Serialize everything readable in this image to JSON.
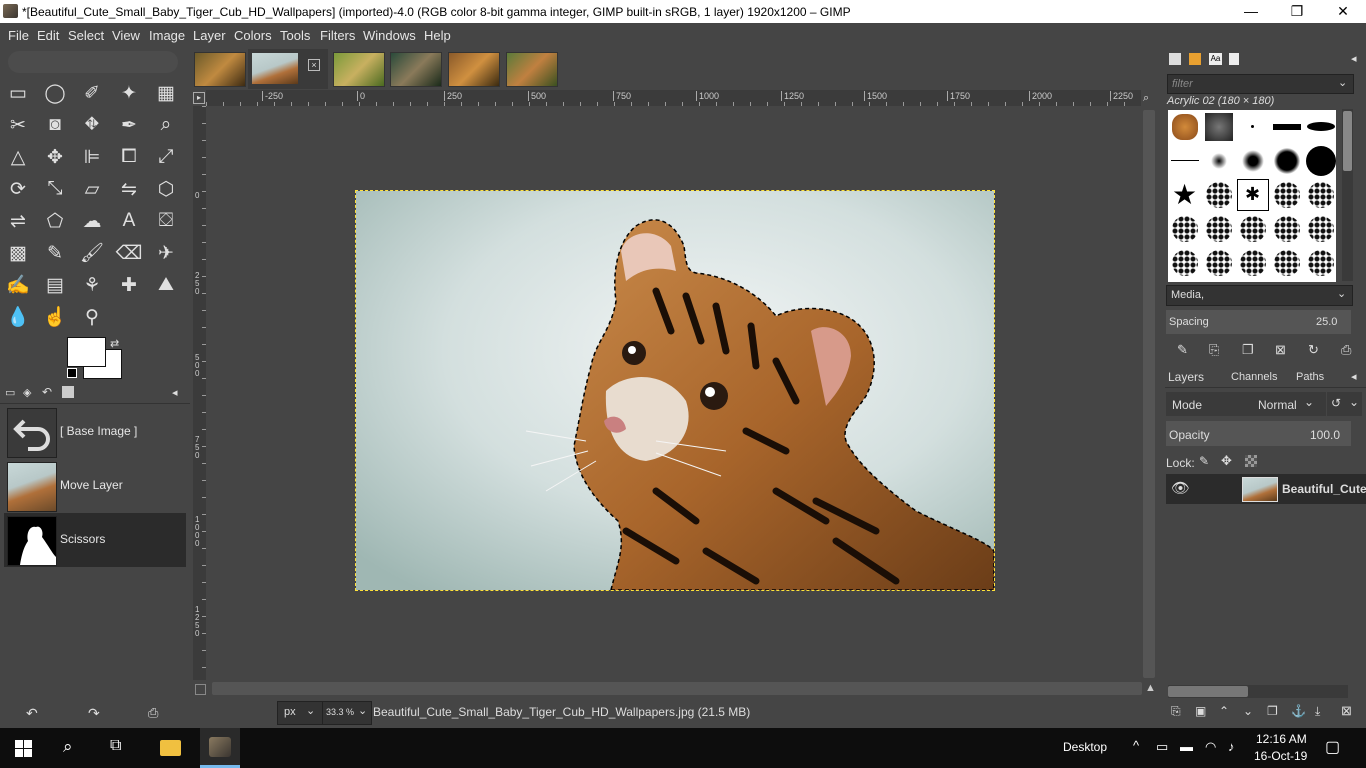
{
  "window": {
    "title": "*[Beautiful_Cute_Small_Baby_Tiger_Cub_HD_Wallpapers] (imported)-4.0 (RGB color 8-bit gamma integer, GIMP built-in sRGB, 1 layer) 1920x1200 – GIMP",
    "minimize": "—",
    "maximize": "❐",
    "close": "✕"
  },
  "menu": [
    "File",
    "Edit",
    "Select",
    "View",
    "Image",
    "Layer",
    "Colors",
    "Tools",
    "Filters",
    "Windows",
    "Help"
  ],
  "colors": {
    "bg": "#454545",
    "dark": "#2b2b2b",
    "accent_selection": "#ffe23a",
    "taskbar": "#0d0d0d"
  },
  "ruler_h_labels": [
    "-250",
    "0",
    "250",
    "500",
    "750",
    "1000",
    "1250",
    "1500",
    "1750",
    "2000",
    "2250"
  ],
  "ruler_v_labels": [
    "0",
    "2 5 0",
    "5 0 0",
    "7 5 0",
    "1 0 0 0",
    "1 2 5 0"
  ],
  "undo_history": [
    {
      "label": "[ Base Image ]"
    },
    {
      "label": "Move Layer"
    },
    {
      "label": "Scissors"
    }
  ],
  "status": {
    "unit": "px",
    "zoom": "33.3 %",
    "filename": "Beautiful_Cute_Small_Baby_Tiger_Cub_HD_Wallpapers.jpg (21.5 MB)"
  },
  "brushes": {
    "filter_placeholder": "filter",
    "current": "Acrylic 02 (180 × 180)",
    "category": "Media,",
    "spacing_label": "Spacing",
    "spacing_value": "25.0"
  },
  "layers": {
    "tabs": [
      "Layers",
      "Channels",
      "Paths"
    ],
    "mode_label": "Mode",
    "mode_value": "Normal",
    "opacity_label": "Opacity",
    "opacity_value": "100.0",
    "lock_label": "Lock:",
    "layer_name": "Beautiful_Cute"
  },
  "taskbar": {
    "desktop": "Desktop",
    "time": "12:16 AM",
    "date": "16-Oct-19"
  }
}
